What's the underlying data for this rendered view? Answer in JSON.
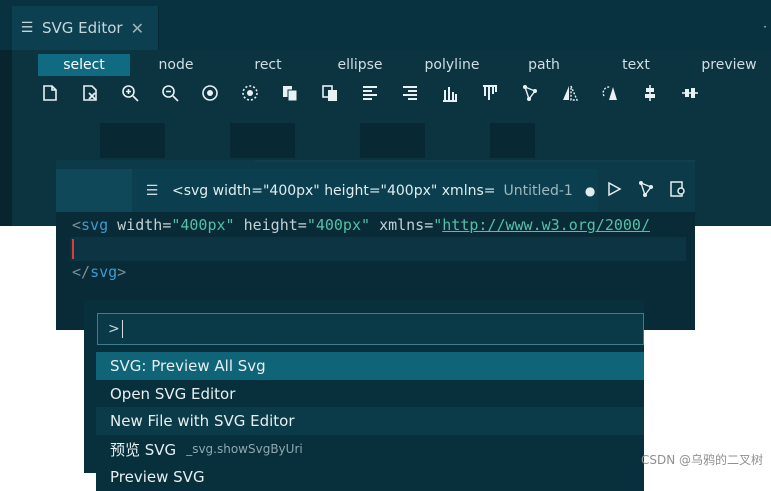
{
  "top_tab": {
    "title": "SVG Editor",
    "close": "✕"
  },
  "modes": [
    "select",
    "node",
    "rect",
    "ellipse",
    "polyline",
    "path",
    "text",
    "preview"
  ],
  "toolbar_icons": [
    "new-file-icon",
    "delete-file-icon",
    "zoom-in-icon",
    "zoom-out-icon",
    "zoom-fit-icon",
    "zoom-select-icon",
    "copy-icon",
    "duplicate-icon",
    "align-left-icon",
    "align-right-icon",
    "align-bottom-icon",
    "align-top-icon",
    "node-graph-icon",
    "flip-vertical-icon",
    "rotate-icon",
    "distribute-vertical-icon",
    "distribute-horizontal-icon"
  ],
  "editor_tab": {
    "title": "<svg width=\"400px\" height=\"400px\" xmlns=",
    "file": "Untitled-1"
  },
  "code": {
    "line1": {
      "open": "<",
      "tag": "svg",
      "attr1": "width",
      "val1": "\"400px\"",
      "attr2": "height",
      "val2": "\"400px\"",
      "attr3": "xmlns",
      "q": "\"",
      "url": "http://www.w3.org/2000/"
    },
    "line3": {
      "open": "</",
      "tag": "svg",
      "close": ">"
    }
  },
  "palette": {
    "input": ">",
    "items": [
      {
        "label": "SVG: Preview All Svg",
        "cmd": ""
      },
      {
        "label": "Open SVG Editor",
        "cmd": ""
      },
      {
        "label": "New File with SVG Editor",
        "cmd": ""
      },
      {
        "label": "预览 SVG",
        "cmd": "_svg.showSvgByUri"
      },
      {
        "label": "Preview SVG",
        "cmd": ""
      }
    ]
  },
  "watermark": "CSDN @乌鸦的二叉树"
}
